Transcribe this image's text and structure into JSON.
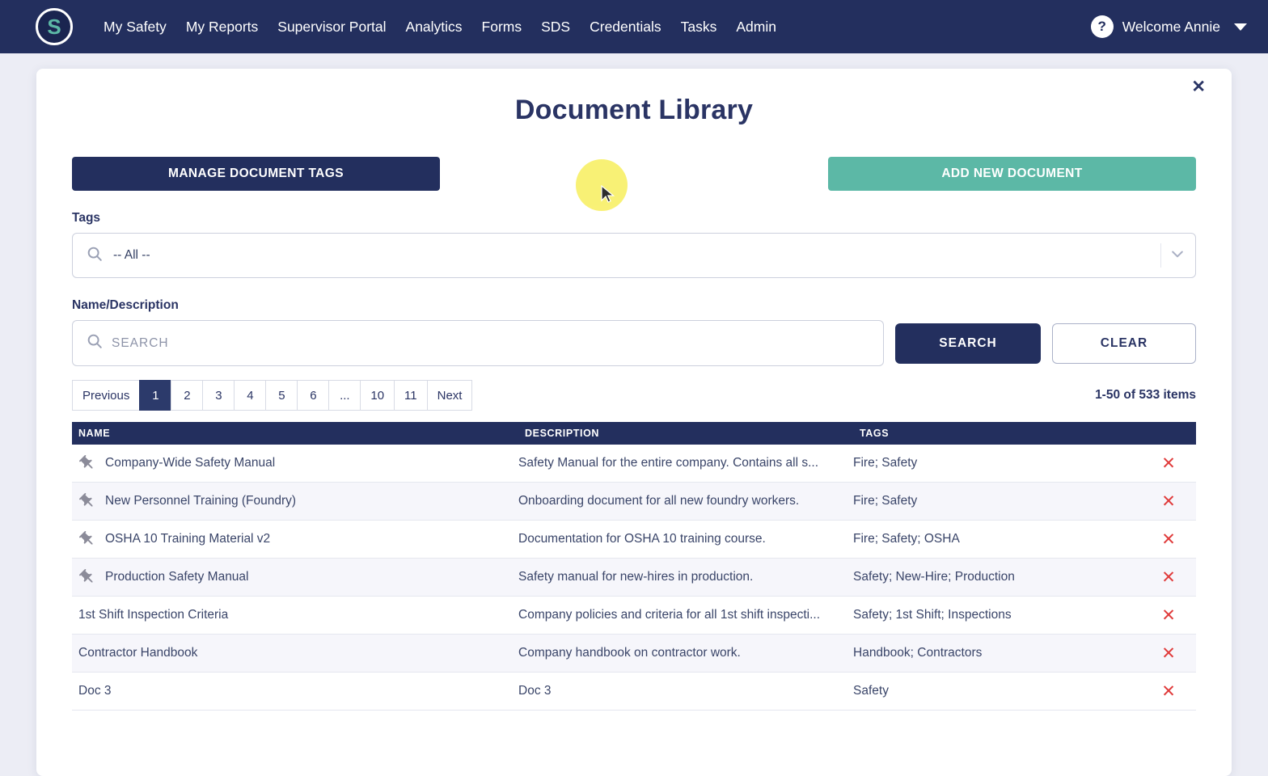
{
  "colors": {
    "navy": "#232f5e",
    "teal": "#5cb8a6",
    "red": "#e03c3c",
    "hl": "#f8f06a"
  },
  "nav": {
    "logo_text": "S",
    "items": [
      "My Safety",
      "My Reports",
      "Supervisor Portal",
      "Analytics",
      "Forms",
      "SDS",
      "Credentials",
      "Tasks",
      "Admin"
    ],
    "help_label": "?",
    "welcome": "Welcome Annie"
  },
  "page": {
    "title": "Document Library",
    "close_label": "✕"
  },
  "actions": {
    "manage_tags": "MANAGE DOCUMENT TAGS",
    "add_document": "ADD NEW DOCUMENT"
  },
  "filters": {
    "tags_label": "Tags",
    "tags_value": "-- All --",
    "name_label": "Name/Description",
    "search_placeholder": "SEARCH",
    "search_button": "SEARCH",
    "clear_button": "CLEAR"
  },
  "pagination": {
    "previous": "Previous",
    "pages": [
      "1",
      "2",
      "3",
      "4",
      "5",
      "6",
      "...",
      "10",
      "11"
    ],
    "active_page": "1",
    "next": "Next",
    "summary": "1-50 of 533 items"
  },
  "table": {
    "headers": [
      "NAME",
      "DESCRIPTION",
      "TAGS"
    ],
    "delete_label": "✕",
    "rows": [
      {
        "pinned": true,
        "name": "Company-Wide Safety Manual",
        "description": "Safety Manual for the entire company. Contains all s...",
        "tags": "Fire; Safety"
      },
      {
        "pinned": true,
        "name": "New Personnel Training (Foundry)",
        "description": "Onboarding document for all new foundry workers.",
        "tags": "Fire; Safety"
      },
      {
        "pinned": true,
        "name": "OSHA 10 Training Material v2",
        "description": "Documentation for OSHA 10 training course.",
        "tags": "Fire; Safety; OSHA"
      },
      {
        "pinned": true,
        "name": "Production Safety Manual",
        "description": "Safety manual for new-hires in production.",
        "tags": "Safety; New-Hire; Production"
      },
      {
        "pinned": false,
        "name": "1st Shift Inspection Criteria",
        "description": "Company policies and criteria for all 1st shift inspecti...",
        "tags": "Safety; 1st Shift; Inspections"
      },
      {
        "pinned": false,
        "name": "Contractor Handbook",
        "description": "Company handbook on contractor work.",
        "tags": "Handbook; Contractors"
      },
      {
        "pinned": false,
        "name": "Doc 3",
        "description": "Doc 3",
        "tags": "Safety"
      }
    ]
  }
}
